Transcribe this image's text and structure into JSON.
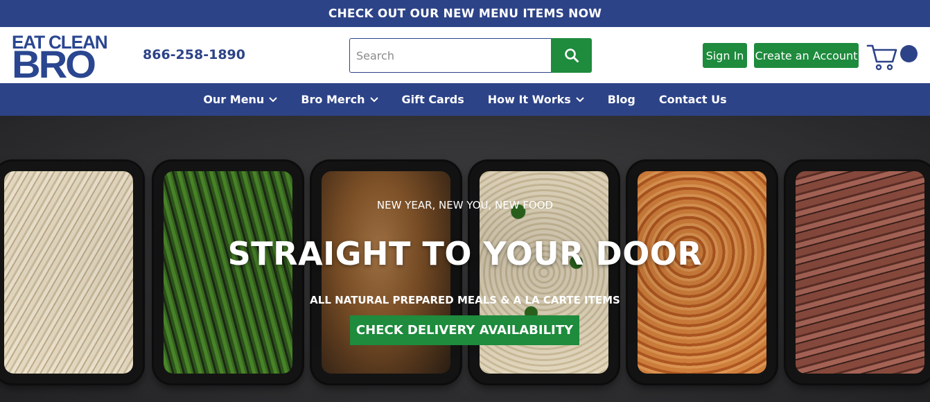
{
  "announcement": {
    "text": "CHECK OUT OUR NEW MENU ITEMS NOW"
  },
  "brand": {
    "logo_line1": "EAT CLEAN",
    "logo_line2": "BRO",
    "phone": "866-258-1890"
  },
  "search": {
    "placeholder": "Search",
    "value": "",
    "icon": "search-icon"
  },
  "account": {
    "sign_in": "Sign In",
    "create_account": "Create an Account",
    "cart_icon": "cart-icon"
  },
  "nav": {
    "items": [
      {
        "label": "Our Menu",
        "has_dropdown": true
      },
      {
        "label": "Bro Merch",
        "has_dropdown": true
      },
      {
        "label": "Gift Cards",
        "has_dropdown": false
      },
      {
        "label": "How It Works",
        "has_dropdown": true
      },
      {
        "label": "Blog",
        "has_dropdown": false
      },
      {
        "label": "Contact Us",
        "has_dropdown": false
      }
    ]
  },
  "hero": {
    "kicker": "NEW YEAR, NEW YOU, NEW FOOD",
    "title": "STRAIGHT TO YOUR DOOR",
    "subtitle": "ALL NATURAL PREPARED MEALS & A LA CARTE ITEMS",
    "cta": "CHECK DELIVERY AVAILABILITY",
    "trays": [
      "shredded-chicken",
      "green-beans",
      "grilled-chicken",
      "mac-and-broccoli",
      "shrimp",
      "sliced-steak"
    ]
  },
  "colors": {
    "brand_blue": "#2d4388",
    "brand_green": "#1e8b3d",
    "logo_blue": "#2a4690"
  }
}
